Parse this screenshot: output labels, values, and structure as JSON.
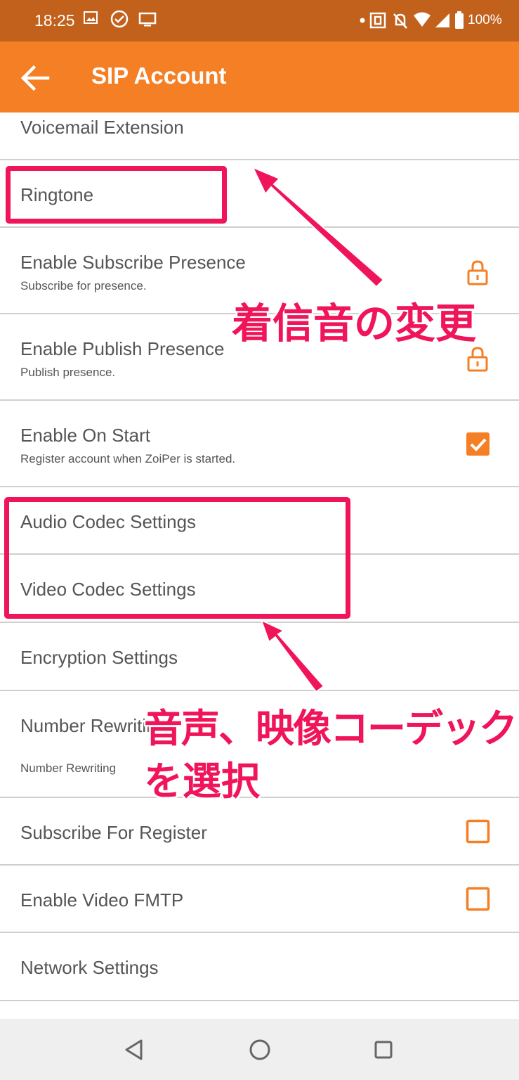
{
  "status_bar": {
    "time": "18:25",
    "battery": "100%",
    "left_icons": [
      "image-icon",
      "check-circle-icon",
      "monitor-icon"
    ],
    "right_icons": [
      "dot-icon",
      "nfc-icon",
      "bell-off-icon",
      "wifi-icon",
      "signal-icon",
      "battery-icon"
    ]
  },
  "app_bar": {
    "title": "SIP Account",
    "back_icon": "back-arrow-icon",
    "color": "#f47f24"
  },
  "settings": {
    "voicemail": {
      "title": "Voicemail Extension"
    },
    "ringtone": {
      "title": "Ringtone"
    },
    "subscribe_presence": {
      "title": "Enable Subscribe Presence",
      "summary": "Subscribe for presence.",
      "control": "lock-icon"
    },
    "publish_presence": {
      "title": "Enable Publish Presence",
      "summary": "Publish presence.",
      "control": "lock-icon"
    },
    "on_start": {
      "title": "Enable On Start",
      "summary": "Register account when ZoiPer is started.",
      "checked": true
    },
    "audio_codec": {
      "title": "Audio Codec Settings"
    },
    "video_codec": {
      "title": "Video Codec Settings"
    },
    "encryption": {
      "title": "Encryption Settings"
    },
    "number_rewriting": {
      "title": "Number Rewriting",
      "summary": "Number Rewriting"
    },
    "subscribe_register": {
      "title": "Subscribe For Register",
      "checked": false
    },
    "video_fmtp": {
      "title": "Enable Video FMTP",
      "checked": false
    },
    "network": {
      "title": "Network Settings"
    }
  },
  "annotations": {
    "ringtone_note": "着信音の変更",
    "codec_note_line1": "音声、映像コーデック",
    "codec_note_line2": "を選択",
    "color": "#f0145a"
  },
  "nav_bar": {
    "buttons": [
      "back-triangle-icon",
      "home-circle-icon",
      "recents-square-icon"
    ]
  }
}
